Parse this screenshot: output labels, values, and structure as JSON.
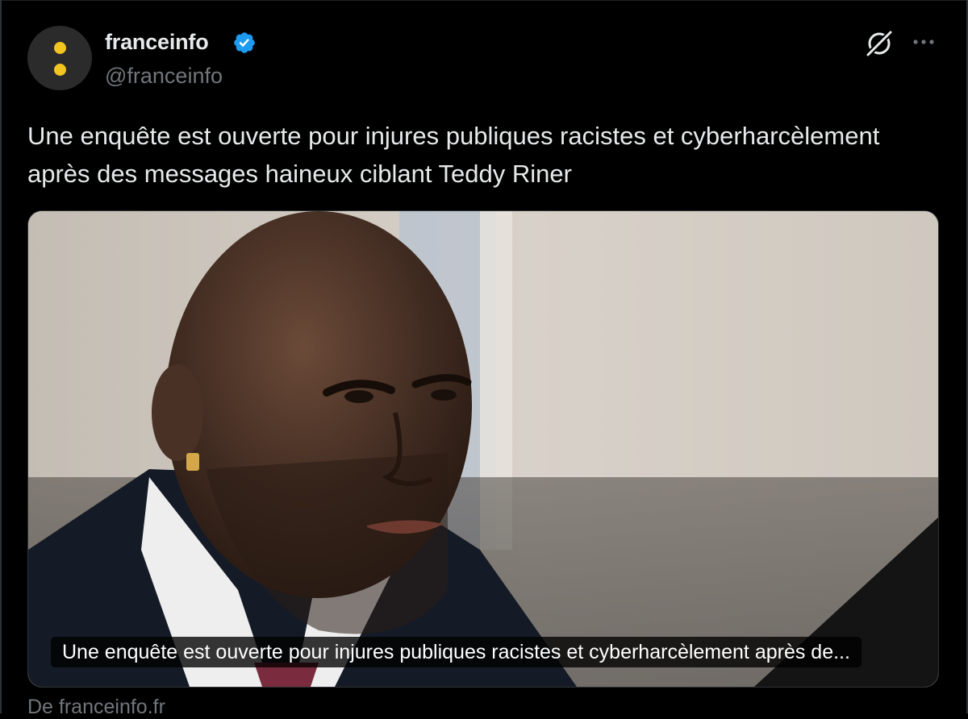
{
  "account": {
    "display_name": "franceinfo",
    "handle": "@franceinfo",
    "verified": true,
    "avatar_color": "#f2c520"
  },
  "tweet": {
    "text": "Une enquête est ouverte pour injures publiques racistes et cyberharcèlement après des messages haineux ciblant Teddy Riner"
  },
  "card": {
    "image_description_icon": "photo-image",
    "caption": "Une enquête est ouverte pour injures publiques racistes et cyberharcèlement après de...",
    "source": "De franceinfo.fr"
  },
  "icons": {
    "grok": "grok-icon",
    "more": "more-options-icon",
    "verified": "verified-badge-icon"
  },
  "colors": {
    "background": "#000000",
    "text": "#e7e9ea",
    "muted": "#71767b",
    "verified_blue": "#1d9bf0"
  }
}
